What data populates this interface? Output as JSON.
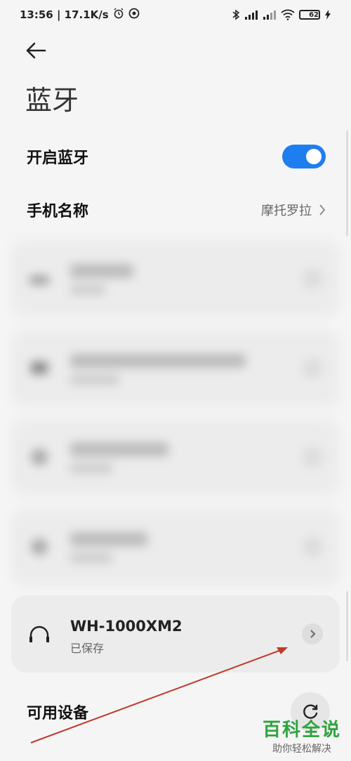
{
  "status_bar": {
    "time_speed": "13:56 | 17.1K/s",
    "battery": "62",
    "battery_level": 0.62
  },
  "page": {
    "title": "蓝牙"
  },
  "settings": {
    "bluetooth_label": "开启蓝牙",
    "bluetooth_on": true,
    "phone_name_label": "手机名称",
    "phone_name_value": "摩托罗拉"
  },
  "paired_devices": [
    {
      "name": "",
      "status": ""
    },
    {
      "name": "",
      "status": ""
    },
    {
      "name": "",
      "status": ""
    },
    {
      "name": "",
      "status": ""
    },
    {
      "name": "WH-1000XM2",
      "status": "已保存",
      "icon": "headphones-icon"
    }
  ],
  "available": {
    "label": "可用设备"
  },
  "watermark": {
    "title": "百科全说",
    "subtitle": "助你轻松解决"
  },
  "colors": {
    "accent": "#1e7ef0",
    "arrow": "#c0392b",
    "watermark": "#2ea43f"
  }
}
